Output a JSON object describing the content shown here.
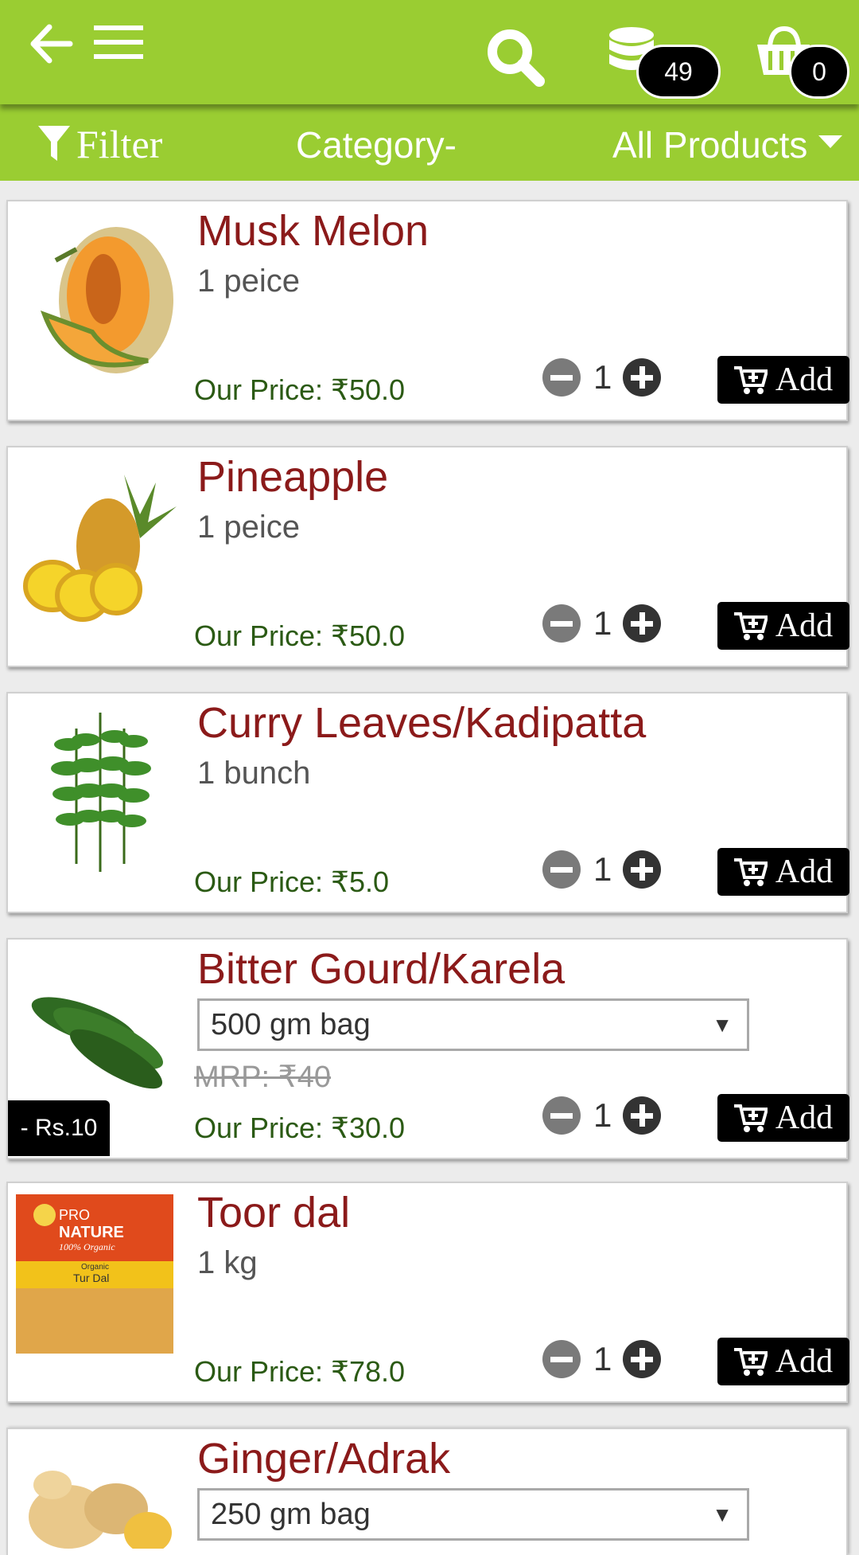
{
  "header": {
    "back_icon": "arrow-left-icon",
    "menu_icon": "hamburger-icon",
    "search_icon": "search-icon",
    "wallet_icon": "coins-stack-icon",
    "wallet_count": "49",
    "cart_icon": "basket-icon",
    "cart_count": "0"
  },
  "filterbar": {
    "filter_label": "Filter",
    "category_label": "Category-",
    "category_value": "All Products"
  },
  "colors": {
    "brand_green": "#9acd32",
    "product_name": "#8b1a1a",
    "price_green": "#2b5a14"
  },
  "products": [
    {
      "name": "Musk Melon",
      "unit": "1 peice",
      "price": "Our Price: ₹50.0",
      "qty": "1",
      "add_label": "Add",
      "image": "musk-melon"
    },
    {
      "name": "Pineapple",
      "unit": "1 peice",
      "price": "Our Price: ₹50.0",
      "qty": "1",
      "add_label": "Add",
      "image": "pineapple"
    },
    {
      "name": "Curry Leaves/Kadipatta",
      "unit": "1 bunch",
      "price": "Our Price: ₹5.0",
      "qty": "1",
      "add_label": "Add",
      "image": "curry-leaves"
    },
    {
      "name": "Bitter Gourd/Karela",
      "variant": "500 gm bag",
      "mrp": "MRP: ₹40",
      "price": "Our Price: ₹30.0",
      "discount": "- Rs.10",
      "qty": "1",
      "add_label": "Add",
      "image": "bitter-gourd"
    },
    {
      "name": "Toor dal",
      "unit": "1 kg",
      "price": "Our Price: ₹78.0",
      "qty": "1",
      "add_label": "Add",
      "image": "toor-dal-pack",
      "pack_brand_line1": "PRO",
      "pack_brand_line2": "NATURE",
      "pack_tagline": "100% Organic",
      "pack_small": "Organic",
      "pack_product": "Tur Dal"
    },
    {
      "name": "Ginger/Adrak",
      "variant": "250 gm bag",
      "image": "ginger"
    }
  ]
}
